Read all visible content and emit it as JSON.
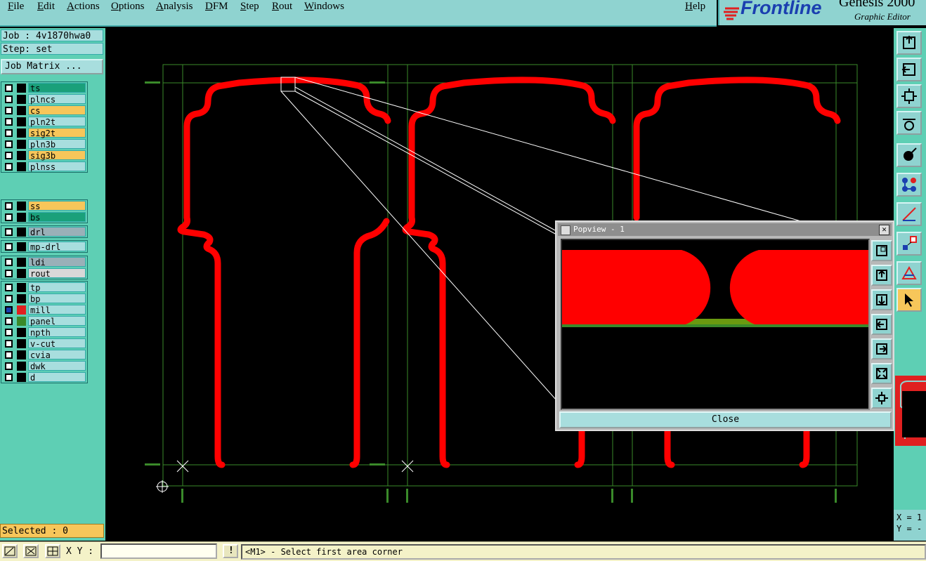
{
  "menubar": {
    "items": [
      "File",
      "Edit",
      "Actions",
      "Options",
      "Analysis",
      "DFM",
      "Step",
      "Rout",
      "Windows"
    ],
    "help": "Help"
  },
  "brand": {
    "logo": "Frontline",
    "title": "Genesis 2000",
    "subtitle": "Graphic Editor"
  },
  "job": {
    "job_line": "Job : 4v1870hwa0",
    "step_line": "Step: set",
    "matrix_button": "Job Matrix ..."
  },
  "layers": [
    {
      "name": "ts",
      "color": "#1aa07a",
      "group": 0
    },
    {
      "name": "plncs",
      "color": "#a8dede",
      "group": 0
    },
    {
      "name": "cs",
      "color": "#f7c65a",
      "group": 0
    },
    {
      "name": "pln2t",
      "color": "#a8dede",
      "group": 0
    },
    {
      "name": "sig2t",
      "color": "#f7c65a",
      "group": 0
    },
    {
      "name": "pln3b",
      "color": "#a8dede",
      "group": 0
    },
    {
      "name": "sig3b",
      "color": "#f7c65a",
      "group": 0
    },
    {
      "name": "plnss",
      "color": "#a8dede",
      "group": 0
    },
    {
      "name": "ss",
      "color": "#f7c65a",
      "group": 1
    },
    {
      "name": "bs",
      "color": "#1aa07a",
      "group": 1
    },
    {
      "name": "drl",
      "color": "#9ab0b8",
      "group": 2
    },
    {
      "name": "mp-drl",
      "color": "#a8dede",
      "group": 3
    },
    {
      "name": "ldi",
      "color": "#9ab0b8",
      "group": 4
    },
    {
      "name": "rout",
      "color": "#d8d8d8",
      "group": 4
    },
    {
      "name": "tp",
      "color": "#a8dede",
      "group": 5
    },
    {
      "name": "bp",
      "color": "#a8dede",
      "group": 5
    },
    {
      "name": "mill",
      "color": "#a8dede",
      "group": 5
    },
    {
      "name": "panel",
      "color": "#a8dede",
      "group": 5
    },
    {
      "name": "npth",
      "color": "#a8dede",
      "group": 5
    },
    {
      "name": "v-cut",
      "color": "#a8dede",
      "group": 5
    },
    {
      "name": "cvia",
      "color": "#a8dede",
      "group": 5
    },
    {
      "name": "dwk",
      "color": "#a8dede",
      "group": 5
    },
    {
      "name": "d",
      "color": "#a8dede",
      "group": 5
    }
  ],
  "selected": "Selected : 0",
  "coords": {
    "x": "X = 1",
    "y": "Y = -"
  },
  "statusbar": {
    "xy_label": "X Y :",
    "xy_value": "",
    "warn_icon": "!",
    "message": "<M1> - Select first area corner"
  },
  "popview": {
    "title": "Popview - 1",
    "close_label": "Close"
  },
  "colors": {
    "board": "#ff0000",
    "outline": "#3a8a2a",
    "teal": "#5ecfb4",
    "highlight": "#f7c65a"
  }
}
